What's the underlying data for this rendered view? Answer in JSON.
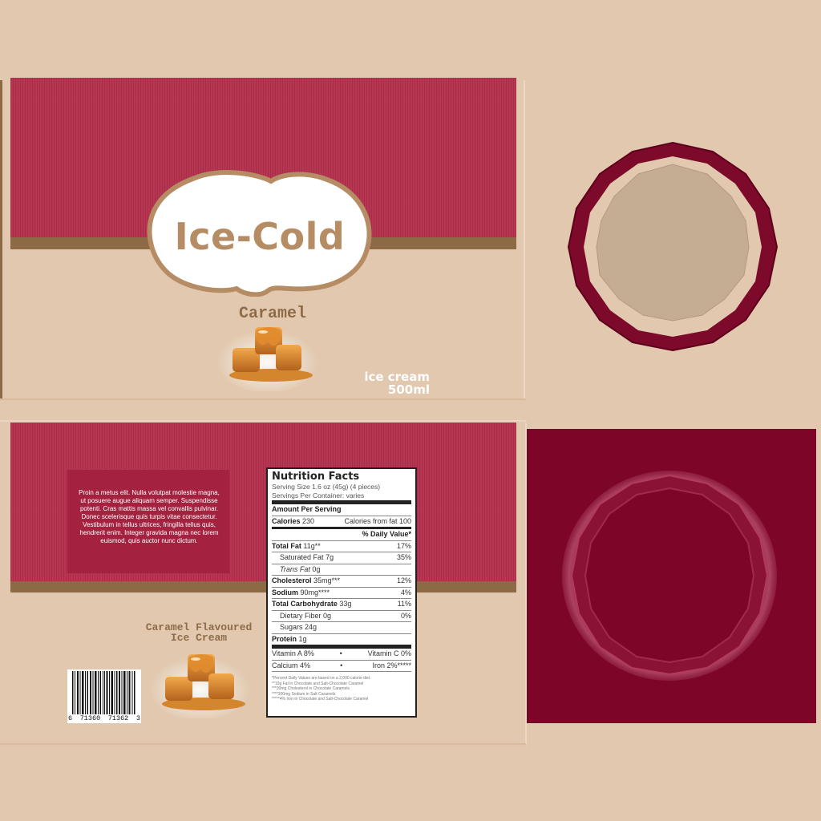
{
  "front": {
    "brand": "Ice-Cold",
    "flavor": "Caramel",
    "product_type": "ice cream",
    "volume": "500ml"
  },
  "back": {
    "description": "Proin a metus elit. Nulla volutpat molestie magna, ut posuere augue aliquam semper. Suspendisse potenti. Cras mattis massa vel convallis pulvinar. Donec scelerisque quis turpis vitae consectetur. Vestibulum in tellus ultrices, fringilla tellus quis, hendrerit enim. Integer gravida magna nec lorem euismod, quis auctor nunc dictum.",
    "subtitle_line1": "Caramel Flavoured",
    "subtitle_line2": "Ice Cream",
    "barcode": {
      "d1": "6",
      "d2": "71360",
      "d3": "71362",
      "d4": "3"
    }
  },
  "nutrition": {
    "title": "Nutrition Facts",
    "serving_size": "Serving Size 1.6 oz (45g) (4 pieces)",
    "servings_per_container": "Servings Per Container: varies",
    "amount_per_serving": "Amount Per Serving",
    "calories_label": "Calories",
    "calories_value": "230",
    "calories_fat": "Calories from fat 100",
    "daily_value_header": "% Daily Value*",
    "rows": [
      {
        "label": "Total Fat",
        "amount": "11g**",
        "dv": "17%"
      },
      {
        "label": "Saturated Fat",
        "amount": "7g",
        "dv": "35%"
      },
      {
        "label": "Trans Fat",
        "amount": "0g",
        "dv": ""
      },
      {
        "label": "Cholesterol",
        "amount": "35mg***",
        "dv": "12%"
      },
      {
        "label": "Sodium",
        "amount": "90mg****",
        "dv": "4%"
      },
      {
        "label": "Total Carbohydrate",
        "amount": "33g",
        "dv": "11%"
      },
      {
        "label": "Dietary Fiber",
        "amount": "0g",
        "dv": "0%"
      },
      {
        "label": "Sugars",
        "amount": "24g",
        "dv": ""
      },
      {
        "label": "Protein",
        "amount": "1g",
        "dv": ""
      }
    ],
    "vitamin_a": "Vitamin A 8%",
    "vitamin_c": "Vitamin C 0%",
    "calcium": "Calcium 4%",
    "iron": "Iron 2%*****",
    "bullet": "•",
    "footnotes": [
      "*Percent Daily Values are based on a 2,000 calorie diet.",
      "**10g Fat in Chocolate and Salt-Chocolate Caramel",
      "***30mg Cholesterol in Chocolate Caramels",
      "****300mg Sodium in Salt Caramels",
      "*****4% Iron in Chocolate and Salt-Chocolate Caramel"
    ]
  },
  "colors": {
    "background": "#e1c8ae",
    "stripe_red": "#b4304d",
    "band_brown": "#8b6a45",
    "lid_red": "#7d0528",
    "brand_text": "#b58c64"
  },
  "icons": {
    "caramel_image": "caramel-candy-illustration",
    "barcode": "barcode-graphic"
  }
}
